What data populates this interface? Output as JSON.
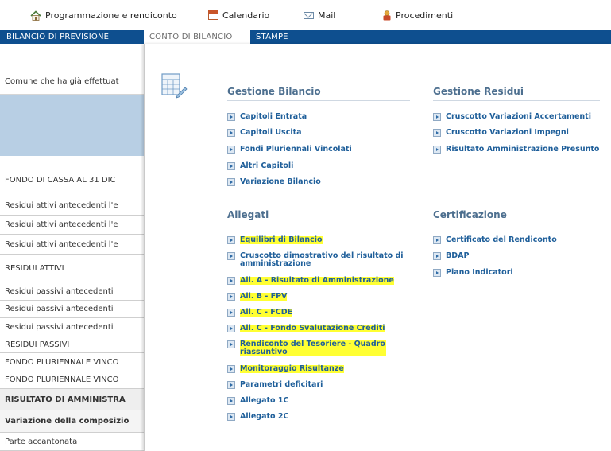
{
  "topbar": {
    "items": [
      {
        "label": "Programmazione e rendiconto",
        "icon": "home-icon"
      },
      {
        "label": "Calendario",
        "icon": "calendar-icon"
      },
      {
        "label": "Mail",
        "icon": "mail-icon"
      },
      {
        "label": "Procedimenti",
        "icon": "procedures-icon"
      }
    ]
  },
  "tabs": [
    {
      "label": "BILANCIO DI PREVISIONE",
      "active": false
    },
    {
      "label": "CONTO DI BILANCIO",
      "active": true
    },
    {
      "label": "STAMPE",
      "active": false
    }
  ],
  "left": {
    "intro": "Comune che ha già effettuat",
    "rows": [
      "FONDO DI CASSA AL 31 DIC",
      "Residui attivi antecedenti l'e",
      "Residui attivi antecedenti l'e",
      "Residui attivi antecedenti l'e",
      "RESIDUI ATTIVI",
      "Residui passivi antecedenti",
      "Residui passivi antecedenti",
      "Residui passivi antecedenti",
      "RESIDUI PASSIVI",
      "FONDO PLURIENNALE VINCO",
      "FONDO PLURIENNALE VINCO",
      "RISULTATO DI AMMINISTRA",
      "Variazione della composizio",
      "Parte accantonata"
    ]
  },
  "menu": {
    "gestione_bilancio": {
      "title": "Gestione Bilancio",
      "items": [
        "Capitoli Entrata",
        "Capitoli Uscita",
        "Fondi Pluriennali Vincolati",
        "Altri Capitoli",
        "Variazione Bilancio"
      ]
    },
    "gestione_residui": {
      "title": "Gestione Residui",
      "items": [
        "Cruscotto Variazioni Accertamenti",
        "Cruscotto Variazioni Impegni",
        "Risultato Amministrazione Presunto"
      ]
    },
    "allegati": {
      "title": "Allegati",
      "items": [
        "Equilibri di Bilancio",
        "Cruscotto dimostrativo del risultato di amministrazione",
        "All. A - Risultato di Amministrazione",
        "All. B - FPV",
        "All. C - FCDE",
        "All. C - Fondo Svalutazione Crediti",
        "Rendiconto del Tesoriere - Quadro riassuntivo",
        "Monitoraggio Risultanze",
        "Parametri deficitari",
        "Allegato 1C",
        "Allegato 2C"
      ]
    },
    "certificazione": {
      "title": "Certificazione",
      "items": [
        "Certificato del Rendiconto",
        "BDAP",
        "Piano Indicatori"
      ]
    }
  },
  "colors": {
    "tabbar": "#0e4f8f",
    "highlight": "#ffff33",
    "link": "#1f5f9a",
    "section_title": "#4d6f8f"
  }
}
